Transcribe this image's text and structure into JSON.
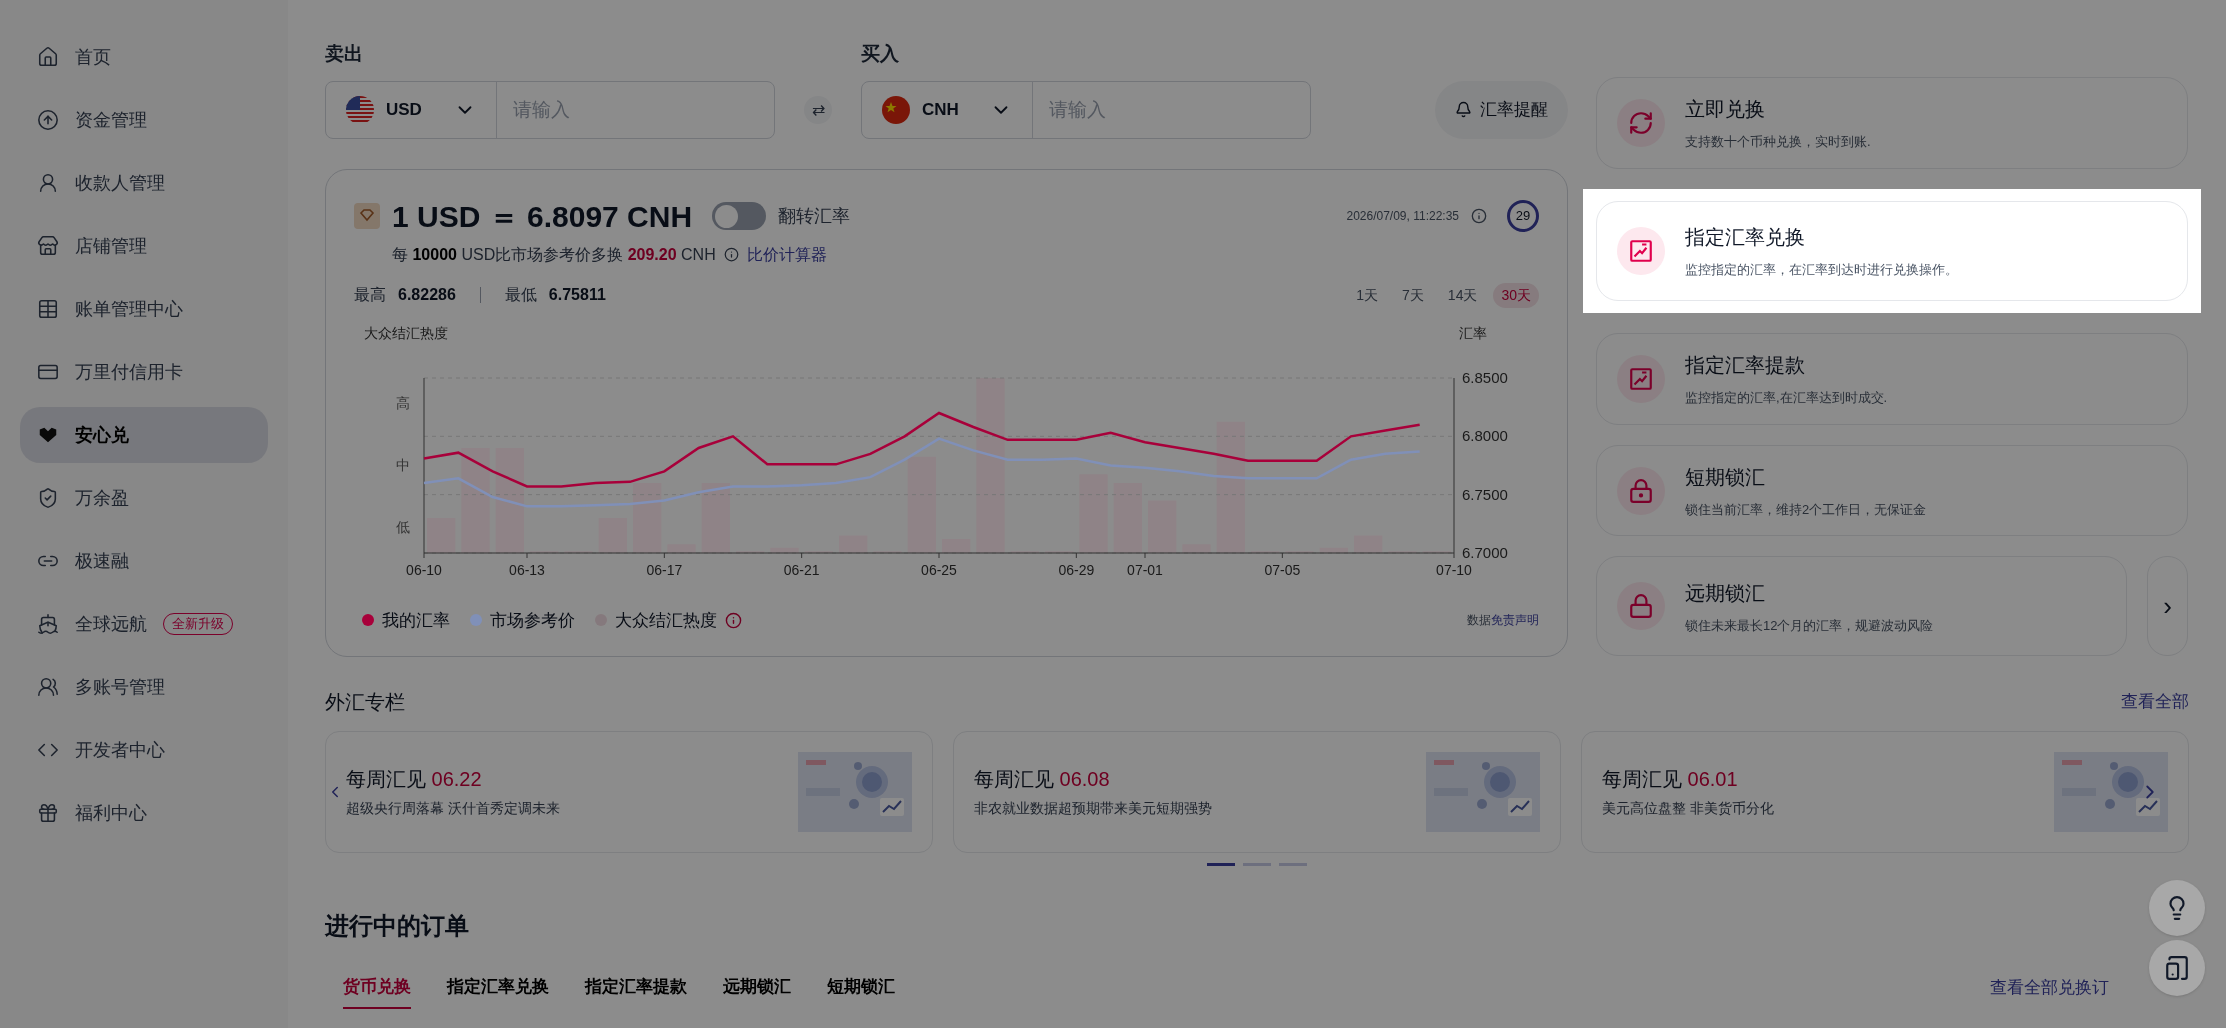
{
  "sidebar": {
    "items": [
      {
        "label": "首页",
        "selected": false
      },
      {
        "label": "资金管理",
        "selected": false
      },
      {
        "label": "收款人管理",
        "selected": false
      },
      {
        "label": "店铺管理",
        "selected": false
      },
      {
        "label": "账单管理中心",
        "selected": false
      },
      {
        "label": "万里付信用卡",
        "selected": false
      },
      {
        "label": "安心兑",
        "selected": true
      },
      {
        "label": "万余盈",
        "selected": false
      },
      {
        "label": "极速融",
        "selected": false
      },
      {
        "label": "全球远航",
        "selected": false,
        "badge": "全新升级"
      },
      {
        "label": "多账号管理",
        "selected": false
      },
      {
        "label": "开发者中心",
        "selected": false
      },
      {
        "label": "福利中心",
        "selected": false
      }
    ]
  },
  "exchange": {
    "sell": {
      "label": "卖出",
      "currency": "USD",
      "placeholder": "请输入"
    },
    "buy": {
      "label": "买入",
      "currency": "CNH",
      "placeholder": "请输入"
    },
    "swap": "⇄",
    "alert_button": "汇率提醒"
  },
  "rate_card": {
    "rate": "1 USD ＝ 6.8097 CNH",
    "flip": {
      "label": "翻转汇率",
      "on": false
    },
    "timestamp": "2026/07/09, 11:22:35",
    "countdown": "29",
    "compare": {
      "prefix": "每",
      "amount": "10000",
      "mid": "USD比市场参考价多换",
      "diff": "209.20",
      "unit": "CNH",
      "link": "比价计算器"
    },
    "high_label": "最高",
    "high": "6.82286",
    "low_label": "最低",
    "low": "6.75811",
    "periods": [
      {
        "label": "1天",
        "selected": false
      },
      {
        "label": "7天",
        "selected": false
      },
      {
        "label": "14天",
        "selected": false
      },
      {
        "label": "30天",
        "selected": true
      }
    ],
    "left_axis_title": "大众结汇热度",
    "left_levels": [
      "高",
      "中",
      "低"
    ],
    "chart_data": {
      "type": "line",
      "ylabel": "汇率",
      "categories": [
        "06-10",
        null,
        null,
        "06-13",
        null,
        null,
        null,
        "06-17",
        null,
        null,
        null,
        "06-21",
        null,
        null,
        null,
        "06-25",
        null,
        null,
        null,
        "06-29",
        null,
        "07-01",
        null,
        null,
        null,
        "07-05",
        null,
        null,
        null,
        null,
        "07-10"
      ],
      "ylim": [
        6.7,
        6.85
      ],
      "yticks": [
        {
          "value": 6.7,
          "label": "6.7000"
        },
        {
          "value": 6.75,
          "label": "6.7500"
        },
        {
          "value": 6.8,
          "label": "6.8000"
        },
        {
          "value": 6.85,
          "label": "6.8500"
        }
      ],
      "series": [
        {
          "name": "我的汇率",
          "color": "#a8003a",
          "values": [
            6.781,
            6.786,
            6.77,
            6.757,
            6.757,
            6.76,
            6.761,
            6.77,
            6.79,
            6.8,
            6.776,
            6.776,
            6.776,
            6.785,
            6.8,
            6.82,
            6.808,
            6.797,
            6.797,
            6.797,
            6.803,
            6.795,
            6.79,
            6.785,
            6.779,
            6.779,
            6.779,
            6.8,
            6.805,
            6.81,
            null
          ]
        },
        {
          "name": "市场参考价",
          "color": "#8090b8",
          "values": [
            6.76,
            6.764,
            6.748,
            6.74,
            6.74,
            6.741,
            6.742,
            6.745,
            6.752,
            6.757,
            6.757,
            6.758,
            6.76,
            6.765,
            6.78,
            6.798,
            6.788,
            6.78,
            6.78,
            6.781,
            6.775,
            6.773,
            6.77,
            6.766,
            6.764,
            6.764,
            6.764,
            6.78,
            6.785,
            6.787,
            null
          ]
        }
      ]
    },
    "heat_legend": "大众结汇热度",
    "disclaimer_prefix": "数据",
    "disclaimer_link": "免责声明"
  },
  "products": [
    {
      "title": "立即兑换",
      "desc": "支持数十个币种兑换，实时到账.",
      "highlighted": false
    },
    {
      "title": "指定汇率兑换",
      "desc": "监控指定的汇率，在汇率到达时进行兑换操作。",
      "highlighted": true
    },
    {
      "title": "指定汇率提款",
      "desc": "监控指定的汇率,在汇率达到时成交.",
      "highlighted": false
    },
    {
      "title": "短期锁汇",
      "desc": "锁住当前汇率，维持2个工作日，无保证金",
      "highlighted": false
    },
    {
      "title": "远期锁汇",
      "desc": "锁住未来最长12个月的汇率，规避波动风险",
      "highlighted": false
    }
  ],
  "products_next": "›",
  "column": {
    "title": "外汇专栏",
    "view_all": "查看全部",
    "articles": [
      {
        "title": "每周汇见",
        "date": "06.22",
        "summary": "超级央行周落幕 沃什首秀定调未来"
      },
      {
        "title": "每周汇见",
        "date": "06.08",
        "summary": "非农就业数据超预期带来美元短期强势"
      },
      {
        "title": "每周汇见",
        "date": "06.01",
        "summary": "美元高位盘整 非美货币分化"
      }
    ],
    "dots": [
      {
        "selected": true
      },
      {
        "selected": false
      },
      {
        "selected": false
      }
    ]
  },
  "orders": {
    "title": "进行中的订单",
    "tabs": [
      {
        "label": "货币兑换",
        "selected": true
      },
      {
        "label": "指定汇率兑换",
        "selected": false
      },
      {
        "label": "指定汇率提款",
        "selected": false
      },
      {
        "label": "远期锁汇",
        "selected": false
      },
      {
        "label": "短期锁汇",
        "selected": false
      }
    ],
    "view_all": "查看全部兑换订"
  }
}
